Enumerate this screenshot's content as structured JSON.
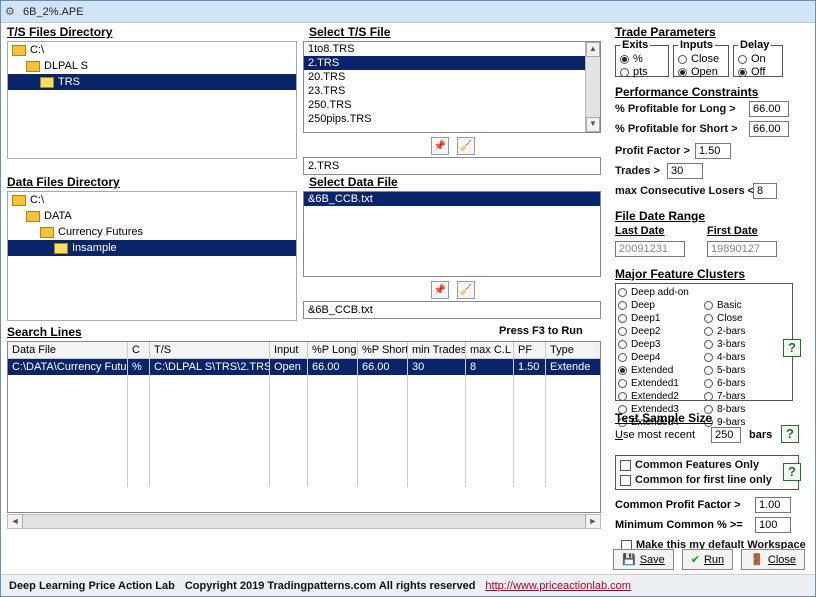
{
  "window": {
    "title": "6B_2%.APE"
  },
  "left": {
    "ts_dir_label": "T/S Files Directory",
    "ts_tree": [
      "C:\\",
      "DLPAL S",
      "TRS"
    ],
    "data_dir_label": "Data Files Directory",
    "data_tree": [
      "C:\\",
      "DATA",
      "Currency Futures",
      "Insample"
    ]
  },
  "mid": {
    "select_ts_label": "Select T/S File",
    "ts_list": [
      "1to8.TRS",
      "2.TRS",
      "20.TRS",
      "23.TRS",
      "250.TRS",
      "250pips.TRS"
    ],
    "ts_selected_index": 1,
    "ts_text": "2.TRS",
    "select_data_label": "Select Data File",
    "data_list": [
      "&6B_CCB.txt"
    ],
    "data_selected_index": 0,
    "data_text": "&6B_CCB.txt"
  },
  "search": {
    "heading": "Search Lines",
    "f3": "Press F3 to Run",
    "cols": [
      "Data File",
      "C",
      "T/S",
      "Input",
      "%P Long",
      "%P Short",
      "min Trades",
      "max C.L",
      "PF",
      "Type"
    ],
    "row": [
      "C:\\DATA\\Currency Futu",
      "%",
      "C:\\DLPAL S\\TRS\\2.TRS",
      "Open",
      "66.00",
      "66.00",
      "30",
      "8",
      "1.50",
      "Extende"
    ]
  },
  "right": {
    "tp_label": "Trade Parameters",
    "exits": {
      "legend": "Exits",
      "pct": "%",
      "pts": "pts",
      "sel": "pct"
    },
    "inputs": {
      "legend": "Inputs",
      "close": "Close",
      "open": "Open",
      "sel": "open"
    },
    "delay": {
      "legend": "Delay",
      "on": "On",
      "off": "Off",
      "sel": "off"
    },
    "pc_label": "Performance Constraints",
    "pc": {
      "profit_long": "% Profitable for Long  >",
      "profit_long_v": "66.00",
      "profit_short": "% Profitable for Short >",
      "profit_short_v": "66.00",
      "pf": "Profit Factor  >",
      "pf_v": "1.50",
      "trades": "Trades  >",
      "trades_v": "30",
      "mcl": "max Consecutive Losers <",
      "mcl_v": "8"
    },
    "fdr_label": "File Date Range",
    "fdr": {
      "last": "Last Date",
      "first": "First Date",
      "last_v": "20091231",
      "first_v": "19890127"
    },
    "mfc_label": "Major Feature Clusters",
    "mfc_sel": "Extended",
    "mfc_left": [
      "Deep add-on",
      "Deep",
      "Deep1",
      "Deep2",
      "Deep3",
      "Deep4",
      "Extended",
      "Extended1",
      "Extended2",
      "Extended3",
      "Extended4"
    ],
    "mfc_right": [
      "",
      "Basic",
      "Close",
      "2-bars",
      "3-bars",
      "4-bars",
      "5-bars",
      "6-bars",
      "7-bars",
      "8-bars",
      "9-bars"
    ],
    "tss_label": "Test Sample Size",
    "tss": {
      "label": "Use most recent",
      "val": "250",
      "unit": "bars"
    },
    "cfo": "Common Features Only",
    "cffl": "Common for first line only",
    "cpf": "Common Profit Factor  >",
    "cpf_v": "1.00",
    "mc": "Minimum Common % >=",
    "mc_v": "100",
    "defw": "Make this my default Workspace"
  },
  "buttons": {
    "save": "Save",
    "run": "Run",
    "close": "Close"
  },
  "footer": {
    "a": "Deep Learning Price Action Lab",
    "b": "Copyright 2019 Tradingpatterns.com  All rights reserved",
    "link": "http://www.priceactionlab.com"
  }
}
